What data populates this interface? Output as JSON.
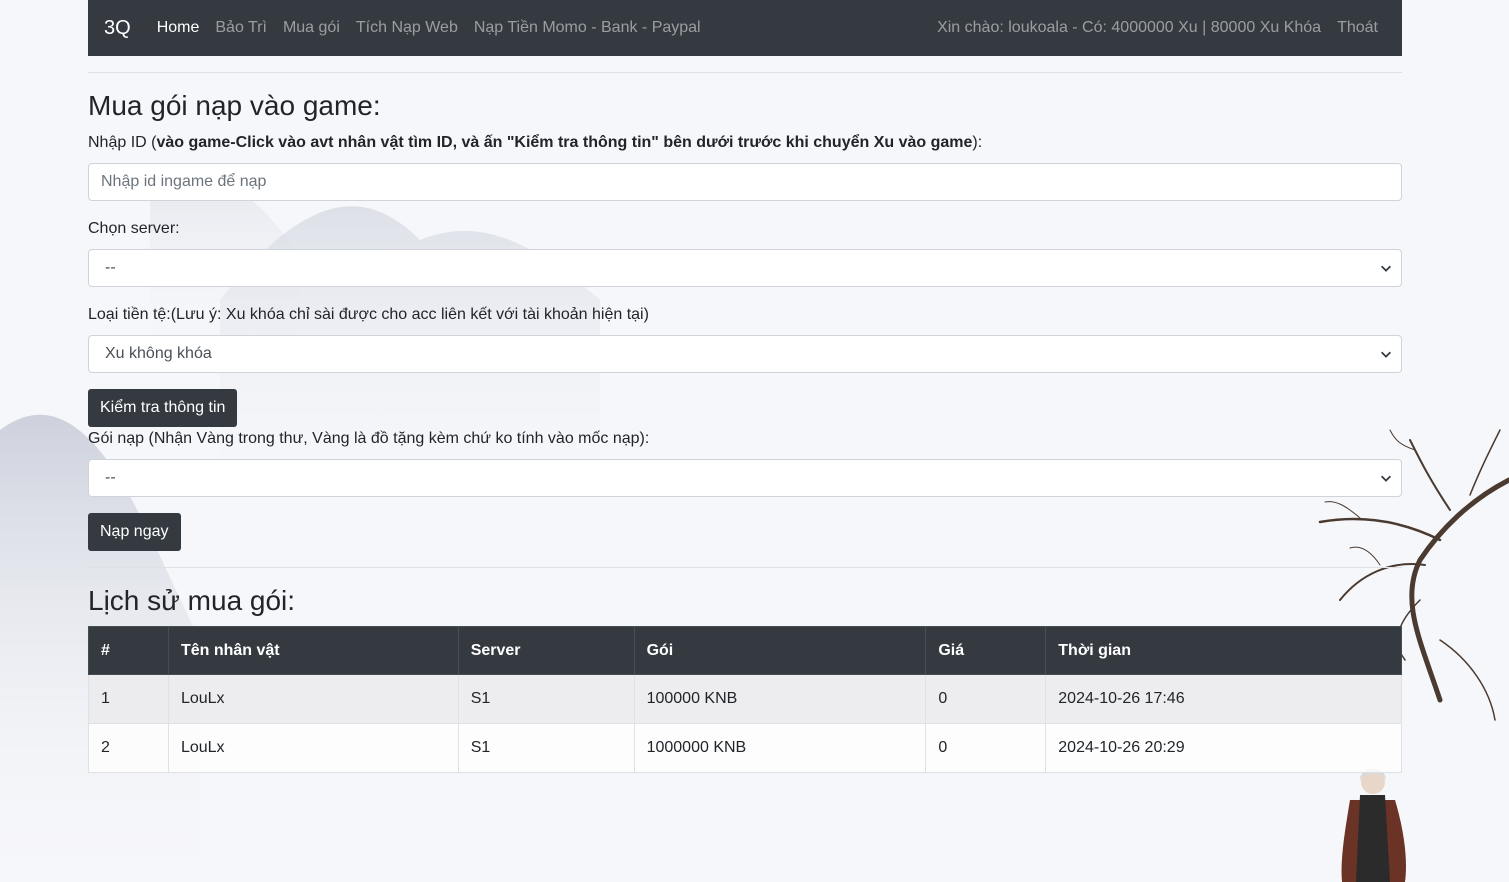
{
  "navbar": {
    "brand": "3Q",
    "links": [
      "Home",
      "Bảo Trì",
      "Mua gói",
      "Tích Nạp Web",
      "Nạp Tiền Momo - Bank - Paypal"
    ],
    "greeting": "Xin chào: loukoala - Có: 4000000 Xu | 80000 Xu Khóa",
    "logout": "Thoát"
  },
  "form": {
    "title": "Mua gói nạp vào game:",
    "id_label_prefix": "Nhập ID (",
    "id_label_bold": "vào game-Click vào avt nhân vật tìm ID, và ấn \"Kiểm tra thông tin\" bên dưới trước khi chuyển Xu vào game",
    "id_label_suffix": "):",
    "id_placeholder": "Nhập id ingame để nạp",
    "server_label": "Chọn server:",
    "server_value": "--",
    "currency_label": "Loại tiền tệ:(Lưu ý: Xu khóa chỉ sài được cho acc liên kết với tài khoản hiện tại)",
    "currency_value": "Xu không khóa",
    "check_button": "Kiểm tra thông tin",
    "package_label": "Gói nạp (Nhận Vàng trong thư, Vàng là đồ tặng kèm chứ ko tính vào mốc nạp):",
    "package_value": "--",
    "submit_button": "Nạp ngay"
  },
  "history": {
    "title": "Lịch sử mua gói:",
    "columns": [
      "#",
      "Tên nhân vật",
      "Server",
      "Gói",
      "Giá",
      "Thời gian"
    ],
    "rows": [
      [
        "1",
        "LouLx",
        "S1",
        "100000 KNB",
        "0",
        "2024-10-26 17:46"
      ],
      [
        "2",
        "LouLx",
        "S1",
        "1000000 KNB",
        "0",
        "2024-10-26 20:29"
      ]
    ]
  }
}
